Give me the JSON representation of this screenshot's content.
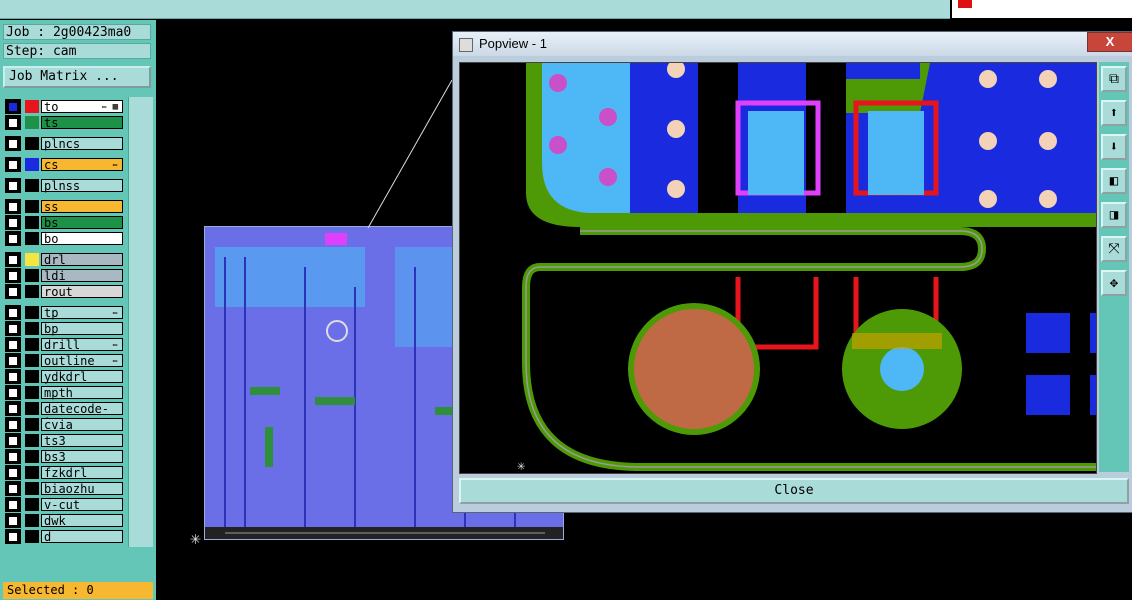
{
  "info": {
    "job": "Job : 2g00423ma0",
    "step": "Step: cam",
    "job_matrix": "Job Matrix ..."
  },
  "layers": [
    {
      "name": "to",
      "color": "#e8141b",
      "bg": "#ffffff",
      "mark": "✏ ▦"
    },
    {
      "name": "ts",
      "color": "#1e9148",
      "bg": "#1e9148",
      "mark": ""
    },
    {
      "name": "plncs",
      "color": "#000000",
      "bg": "#a9dbd9",
      "mark": ""
    },
    {
      "name": "cs",
      "color": "#1a2bdf",
      "bg": "#f7b731",
      "mark": "✏"
    },
    {
      "name": "plnss",
      "color": "#000000",
      "bg": "#a9dbd9",
      "mark": ""
    },
    {
      "name": "ss",
      "color": "#000000",
      "bg": "#f7b731",
      "mark": ""
    },
    {
      "name": "bs",
      "color": "#000000",
      "bg": "#1e9148",
      "mark": ""
    },
    {
      "name": "bo",
      "color": "#000000",
      "bg": "#ffffff",
      "mark": ""
    },
    {
      "name": "drl",
      "color": "#f4e542",
      "bg": "#a9b9c3",
      "mark": ""
    },
    {
      "name": "ldi",
      "color": "#000000",
      "bg": "#a9b9c3",
      "mark": ""
    },
    {
      "name": "rout",
      "color": "#000000",
      "bg": "#d8d8d8",
      "mark": ""
    },
    {
      "name": "tp",
      "color": "#000000",
      "bg": "#a9dbd9",
      "mark": "✏"
    },
    {
      "name": "bp",
      "color": "#000000",
      "bg": "#a9dbd9",
      "mark": ""
    },
    {
      "name": "drill",
      "color": "#000000",
      "bg": "#a9dbd9",
      "mark": "✏"
    },
    {
      "name": "outline",
      "color": "#000000",
      "bg": "#a9dbd9",
      "mark": "✏"
    },
    {
      "name": "ydkdrl",
      "color": "#000000",
      "bg": "#a9dbd9",
      "mark": ""
    },
    {
      "name": "mpth",
      "color": "#000000",
      "bg": "#a9dbd9",
      "mark": ""
    },
    {
      "name": "datecode-to",
      "color": "#000000",
      "bg": "#a9dbd9",
      "mark": ""
    },
    {
      "name": "cvia",
      "color": "#000000",
      "bg": "#a9dbd9",
      "mark": ""
    },
    {
      "name": "ts3",
      "color": "#000000",
      "bg": "#a9dbd9",
      "mark": ""
    },
    {
      "name": "bs3",
      "color": "#000000",
      "bg": "#a9dbd9",
      "mark": ""
    },
    {
      "name": "fzkdrl",
      "color": "#000000",
      "bg": "#a9dbd9",
      "mark": ""
    },
    {
      "name": "biaozhu",
      "color": "#000000",
      "bg": "#a9dbd9",
      "mark": ""
    },
    {
      "name": "v-cut",
      "color": "#000000",
      "bg": "#a9dbd9",
      "mark": ""
    },
    {
      "name": "dwk",
      "color": "#000000",
      "bg": "#a9dbd9",
      "mark": ""
    },
    {
      "name": "d",
      "color": "#000000",
      "bg": "#a9dbd9",
      "mark": ""
    }
  ],
  "status": {
    "selected": "Selected : 0"
  },
  "popview": {
    "title": "Popview - 1",
    "close_x": "X",
    "close_button": "Close"
  },
  "tools": [
    "copy-icon",
    "layer-up-icon",
    "layer-down-icon",
    "pan-left-icon",
    "pan-right-icon",
    "zoom-fit-icon",
    "zoom-home-icon"
  ],
  "colors": {
    "panel": "#63c6b6",
    "field": "#a9dbd9",
    "copper_blue": "#1a2bdf",
    "mask_green": "#4e9a06",
    "pad_light": "#4eb7f5",
    "red_trace": "#e8141b"
  }
}
